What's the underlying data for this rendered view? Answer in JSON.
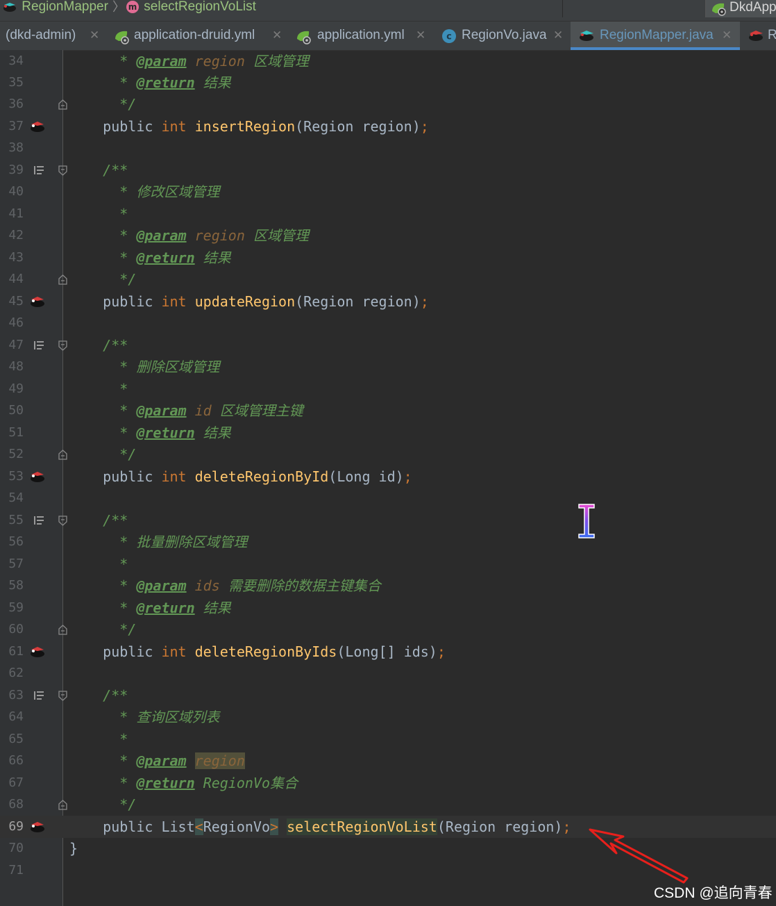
{
  "breadcrumb": {
    "class_label": "RegionMapper",
    "method_label": "selectRegionVoList"
  },
  "run_config": {
    "label": "DkdApp"
  },
  "tabs": [
    {
      "label": "(dkd-admin)",
      "icon": "none"
    },
    {
      "label": "application-druid.yml",
      "icon": "spring-yml-icon"
    },
    {
      "label": "application.yml",
      "icon": "spring-yml-icon"
    },
    {
      "label": "RegionVo.java",
      "icon": "java-class-icon"
    },
    {
      "label": "RegionMapper.java",
      "icon": "mybatis-mapper-icon",
      "active": true
    },
    {
      "label": "R",
      "icon": "mybatis-mapper-icon"
    }
  ],
  "code_lines": [
    {
      "num": "34",
      "marker": "none"
    },
    {
      "num": "35",
      "marker": "none"
    },
    {
      "num": "36",
      "marker": "fold-end"
    },
    {
      "num": "37",
      "marker": "mybatis"
    },
    {
      "num": "38",
      "marker": "none"
    },
    {
      "num": "39",
      "marker": "impl+fold"
    },
    {
      "num": "40",
      "marker": "none"
    },
    {
      "num": "41",
      "marker": "none"
    },
    {
      "num": "42",
      "marker": "none"
    },
    {
      "num": "43",
      "marker": "none"
    },
    {
      "num": "44",
      "marker": "fold-end"
    },
    {
      "num": "45",
      "marker": "mybatis"
    },
    {
      "num": "46",
      "marker": "none"
    },
    {
      "num": "47",
      "marker": "impl+fold"
    },
    {
      "num": "48",
      "marker": "none"
    },
    {
      "num": "49",
      "marker": "none"
    },
    {
      "num": "50",
      "marker": "none"
    },
    {
      "num": "51",
      "marker": "none"
    },
    {
      "num": "52",
      "marker": "fold-end"
    },
    {
      "num": "53",
      "marker": "mybatis"
    },
    {
      "num": "54",
      "marker": "none"
    },
    {
      "num": "55",
      "marker": "impl+fold"
    },
    {
      "num": "56",
      "marker": "none"
    },
    {
      "num": "57",
      "marker": "none"
    },
    {
      "num": "58",
      "marker": "none"
    },
    {
      "num": "59",
      "marker": "none"
    },
    {
      "num": "60",
      "marker": "fold-end"
    },
    {
      "num": "61",
      "marker": "mybatis"
    },
    {
      "num": "62",
      "marker": "none"
    },
    {
      "num": "63",
      "marker": "impl+fold"
    },
    {
      "num": "64",
      "marker": "none"
    },
    {
      "num": "65",
      "marker": "none"
    },
    {
      "num": "66",
      "marker": "none"
    },
    {
      "num": "67",
      "marker": "none"
    },
    {
      "num": "68",
      "marker": "fold-end"
    },
    {
      "num": "69",
      "marker": "mybatis",
      "current": true
    },
    {
      "num": "70",
      "marker": "none"
    },
    {
      "num": "71",
      "marker": "none"
    }
  ],
  "code": {
    "l34": {
      "star": "* ",
      "tag": "@param",
      "name": "region",
      "desc": "区域管理"
    },
    "l35": {
      "star": "* ",
      "tag": "@return",
      "desc": "结果"
    },
    "l36": {
      "text": "*/"
    },
    "l37": {
      "mod": "public",
      "type": "int",
      "name": "insertRegion",
      "args": "(Region region)",
      "end": ";"
    },
    "l39": {
      "text": "/**"
    },
    "l40": {
      "text": "* 修改区域管理"
    },
    "l41": {
      "text": "*"
    },
    "l42": {
      "star": "* ",
      "tag": "@param",
      "name": "region",
      "desc": "区域管理"
    },
    "l43": {
      "star": "* ",
      "tag": "@return",
      "desc": "结果"
    },
    "l44": {
      "text": "*/"
    },
    "l45": {
      "mod": "public",
      "type": "int",
      "name": "updateRegion",
      "args": "(Region region)",
      "end": ";"
    },
    "l47": {
      "text": "/**"
    },
    "l48": {
      "text": "* 删除区域管理"
    },
    "l49": {
      "text": "*"
    },
    "l50": {
      "star": "* ",
      "tag": "@param",
      "name": "id",
      "desc": "区域管理主键"
    },
    "l51": {
      "star": "* ",
      "tag": "@return",
      "desc": "结果"
    },
    "l52": {
      "text": "*/"
    },
    "l53": {
      "mod": "public",
      "type": "int",
      "name": "deleteRegionById",
      "args": "(Long id)",
      "end": ";"
    },
    "l55": {
      "text": "/**"
    },
    "l56": {
      "text": "* 批量删除区域管理"
    },
    "l57": {
      "text": "*"
    },
    "l58": {
      "star": "* ",
      "tag": "@param",
      "name": "ids",
      "desc": "需要删除的数据主键集合"
    },
    "l59": {
      "star": "* ",
      "tag": "@return",
      "desc": "结果"
    },
    "l60": {
      "text": "*/"
    },
    "l61": {
      "mod": "public",
      "type": "int",
      "name": "deleteRegionByIds",
      "args": "(Long[] ids)",
      "end": ";"
    },
    "l63": {
      "text": "/**"
    },
    "l64": {
      "text": "* 查询区域列表"
    },
    "l65": {
      "text": "*"
    },
    "l66": {
      "star": "* ",
      "tag": "@param",
      "name": "region"
    },
    "l67": {
      "star": "* ",
      "tag": "@return",
      "desc": "RegionVo集合"
    },
    "l68": {
      "text": "*/"
    },
    "l69": {
      "mod": "public",
      "list": "List",
      "lt": "<",
      "generic": "RegionVo",
      "gt": ">",
      "name": "selectRegionVoList",
      "args": "(Region region)",
      "end": ";"
    },
    "l70": {
      "text": "}"
    }
  },
  "watermark": "CSDN @追向青春",
  "colors": {
    "keyword": "#cc7832",
    "method": "#ffc66d",
    "doc_comment": "#629755",
    "text": "#a9b7c6",
    "background": "#2b2b2b",
    "annotation_arrow": "#e8201c"
  }
}
